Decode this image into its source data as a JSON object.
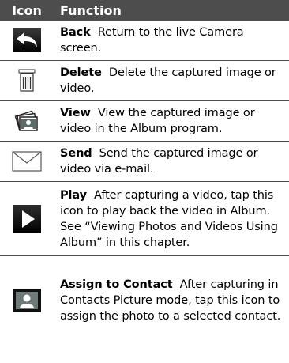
{
  "header": {
    "icon_label": "Icon",
    "function_label": "Function"
  },
  "rows": [
    {
      "icon": "back-arrow-icon",
      "title": "Back",
      "desc": "Return to the live Camera screen."
    },
    {
      "icon": "trash-bin-icon",
      "title": "Delete",
      "desc": "Delete the captured image or video."
    },
    {
      "icon": "photo-stack-icon",
      "title": "View",
      "desc": "View the captured image or video in the Album program."
    },
    {
      "icon": "envelope-icon",
      "title": "Send",
      "desc": "Send the captured image or video via e-mail."
    },
    {
      "icon": "play-icon",
      "title": "Play",
      "desc": "After capturing a video, tap this icon to play back the video in Album. See “Viewing Photos and Videos Using Album” in this chapter."
    },
    {
      "icon": "contact-card-icon",
      "title": "Assign to Contact",
      "desc": "After capturing in Contacts Picture mode, tap this icon to assign the photo to a selected contact."
    }
  ],
  "colors": {
    "header_bg": "#4d4d4d",
    "header_text": "#ffffff",
    "divider": "#4d4d4d"
  }
}
